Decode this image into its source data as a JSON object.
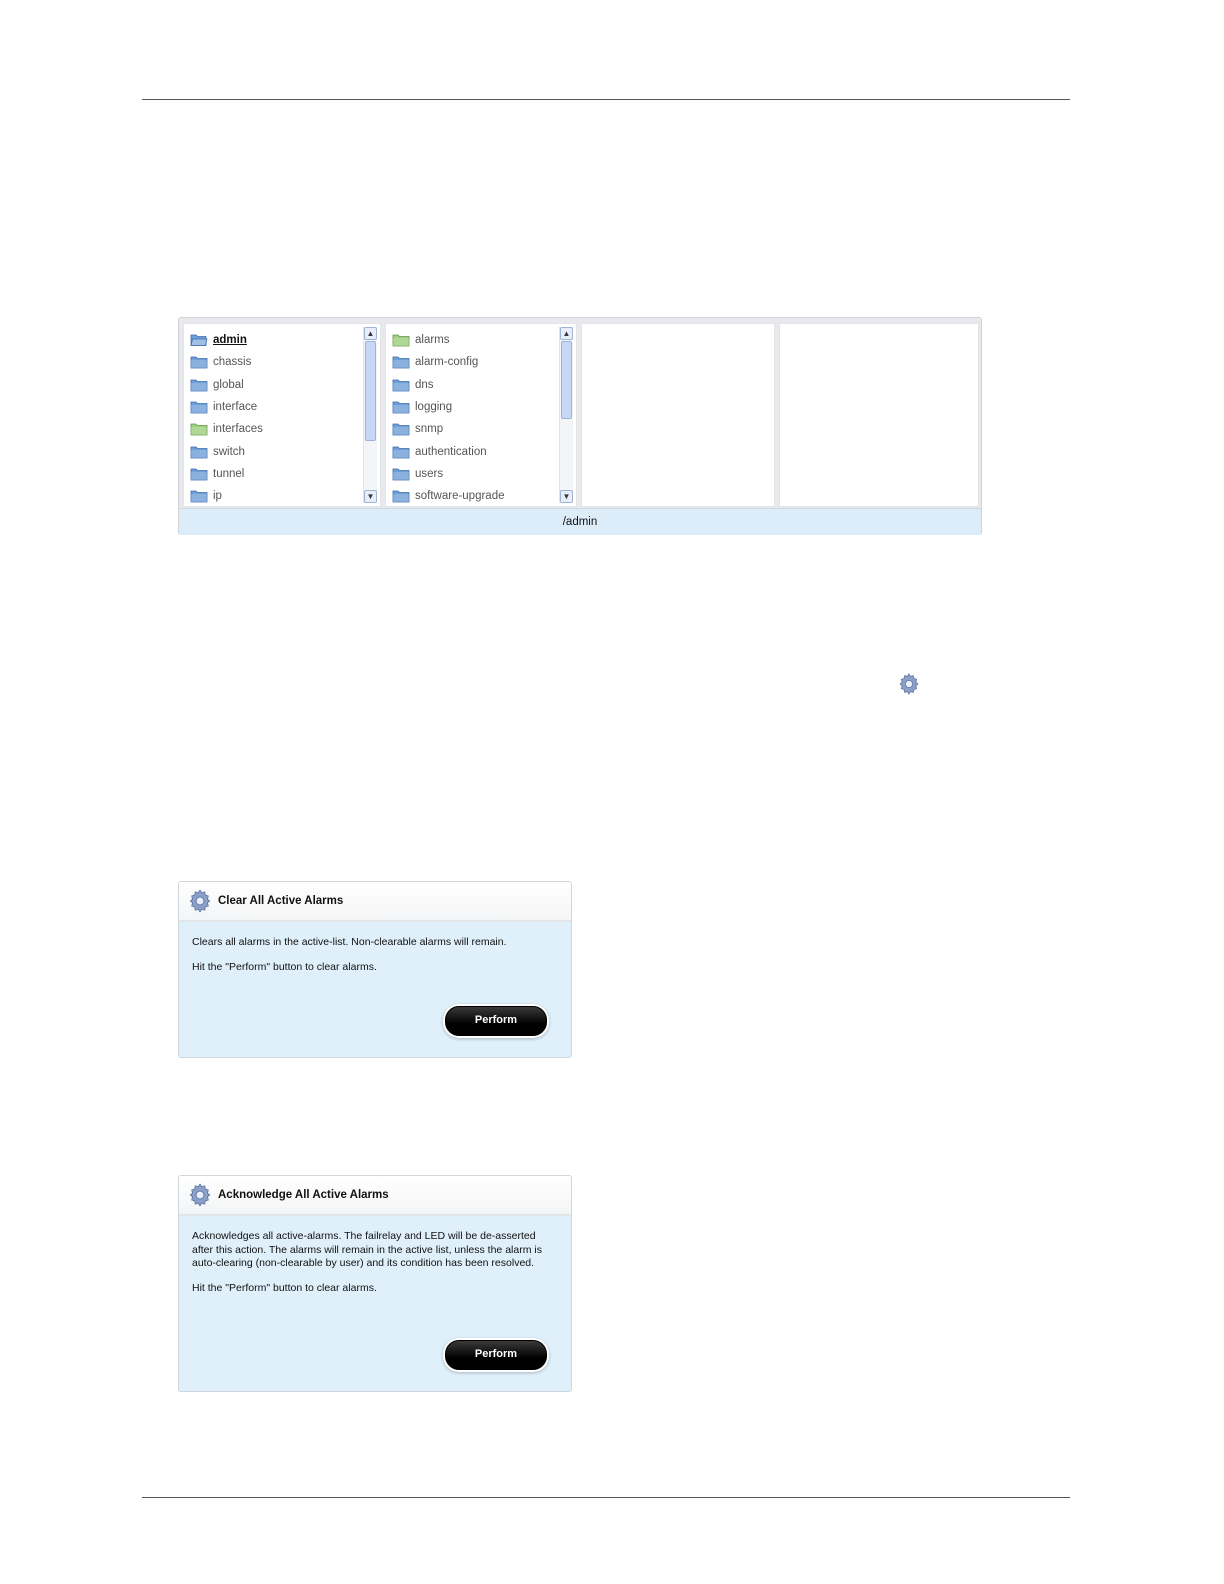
{
  "browser": {
    "column1": [
      {
        "label": "admin",
        "color": "blue",
        "selected": true
      },
      {
        "label": "chassis",
        "color": "blue"
      },
      {
        "label": "global",
        "color": "blue"
      },
      {
        "label": "interface",
        "color": "blue"
      },
      {
        "label": "interfaces",
        "color": "green"
      },
      {
        "label": "switch",
        "color": "blue"
      },
      {
        "label": "tunnel",
        "color": "blue"
      },
      {
        "label": "ip",
        "color": "blue"
      }
    ],
    "column2": [
      {
        "label": "alarms",
        "color": "green"
      },
      {
        "label": "alarm-config",
        "color": "blue"
      },
      {
        "label": "dns",
        "color": "blue"
      },
      {
        "label": "logging",
        "color": "blue"
      },
      {
        "label": "snmp",
        "color": "blue"
      },
      {
        "label": "authentication",
        "color": "blue"
      },
      {
        "label": "users",
        "color": "blue"
      },
      {
        "label": "software-upgrade",
        "color": "blue"
      }
    ],
    "path": "/admin"
  },
  "panels": [
    {
      "title": "Clear All Active Alarms",
      "paragraphs": [
        "Clears all alarms in the active-list. Non-clearable alarms will remain.",
        "Hit the \"Perform\" button to clear alarms."
      ],
      "button": "Perform"
    },
    {
      "title": "Acknowledge All Active Alarms",
      "paragraphs": [
        "Acknowledges all active-alarms. The failrelay and LED will be de-asserted after this action. The alarms will remain in the active list, unless the alarm is auto-clearing (non-clearable by user) and its condition has been resolved.",
        "Hit the \"Perform\" button to clear alarms."
      ],
      "button": "Perform"
    }
  ],
  "colors": {
    "folder_blue": "#6f9fd8",
    "folder_green": "#9ccf7e",
    "panel_bg": "#dff0fb",
    "pathbar_bg": "#dcecf9"
  }
}
